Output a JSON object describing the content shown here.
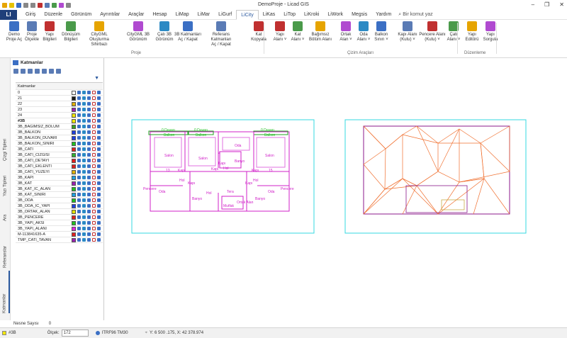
{
  "window": {
    "title": "DemoProje - Licad GIS"
  },
  "menubar": {
    "logo": "LI",
    "tabs": [
      "Giriş",
      "Düzenle",
      "Görünüm",
      "Ayrıntılar",
      "Araçlar",
      "Hesap",
      "LiMap",
      "LiMar",
      "LiGurf",
      "LiCity",
      "LiKas",
      "LiTop",
      "LiKroki",
      "LiWork",
      "Megsis",
      "Yardım"
    ],
    "active_tab": "LiCity",
    "search_label": "Bir komut yaz"
  },
  "ribbon": {
    "proje_buttons": [
      {
        "label1": "Demo",
        "label2": "Proje Aç",
        "icon": "project-open-icon"
      },
      {
        "label1": "Proje",
        "label2": "Ölçekle",
        "icon": "scale-icon"
      },
      {
        "label1": "Yapı",
        "label2": "Bilgileri",
        "icon": "building-info-icon"
      },
      {
        "label1": "Dönüşüm",
        "label2": "Bilgileri",
        "icon": "transform-icon"
      },
      {
        "label1": "CityGML",
        "label2": "Oluşturma Sihirbazı",
        "icon": "citygml-icon"
      },
      {
        "label1": "CityGML 3B",
        "label2": "Görünüm",
        "icon": "citygml-3d-icon"
      },
      {
        "label1": "Çatı 3B",
        "label2": "Görünüm",
        "icon": "roof-3d-icon"
      },
      {
        "label1": "3B Katmanları",
        "label2": "Aç / Kapat",
        "icon": "layers-3d-icon"
      },
      {
        "label1": "Referans Katmanları",
        "label2": "Aç / Kapat",
        "icon": "ref-layers-icon"
      },
      {
        "label1": "Kat",
        "label2": "Kopyala",
        "icon": "floor-copy-icon"
      }
    ],
    "cizim_buttons": [
      {
        "label1": "Yapı",
        "label2": "Alanı ˅",
        "icon": "building-area-icon"
      },
      {
        "label1": "Kat",
        "label2": "Alanı ˅",
        "icon": "floor-area-icon"
      },
      {
        "label1": "Bağımsız",
        "label2": "Bölüm Alanı",
        "icon": "unit-area-icon"
      },
      {
        "label1": "Ortak",
        "label2": "Alan ˅",
        "icon": "common-area-icon"
      },
      {
        "label1": "Oda",
        "label2": "Alanı ˅",
        "icon": "room-area-icon"
      },
      {
        "label1": "Balkon",
        "label2": "Sınırı ˅",
        "icon": "balcony-icon"
      },
      {
        "label1": "Kapı Alanı",
        "label2": "(Kutu) ˅",
        "icon": "door-area-icon"
      },
      {
        "label1": "Pencere Alanı",
        "label2": "(Kutu) ˅",
        "icon": "window-area-icon"
      },
      {
        "label1": "Çatı",
        "label2": "Alanı ˅",
        "icon": "roof-area-icon"
      }
    ],
    "duzenleme_buttons": [
      {
        "label1": "Yapı",
        "label2": "Editörü",
        "icon": "building-editor-icon"
      },
      {
        "label1": "Yapı",
        "label2": "Sorgula",
        "icon": "building-query-icon"
      }
    ],
    "groups": {
      "proje": "Proje",
      "cizim": "Çizim Araçları",
      "duzenleme": "Düzenleme"
    }
  },
  "sidebar_tabs": [
    "Katmanlar",
    "Referanslar",
    "Ara",
    "Yazı Tipleri",
    "Çizgi Tipleri"
  ],
  "panel": {
    "title": "Katmanlar",
    "column_header": "Katmanlar",
    "layers": [
      {
        "name": "0",
        "color": "#ffffff"
      },
      {
        "name": "21",
        "color": "#1a1a1a"
      },
      {
        "name": "22",
        "color": "#e0b000"
      },
      {
        "name": "23",
        "color": "#9b1fb0"
      },
      {
        "name": "24",
        "color": "#f2e600"
      },
      {
        "name": "#3B",
        "color": "#f2e600",
        "current": true
      },
      {
        "name": "3B_BAGIMSIZ_BOLUM",
        "color": "#3aa020"
      },
      {
        "name": "3B_BALKON",
        "color": "#2040e0"
      },
      {
        "name": "3B_BALKON_DUVARI",
        "color": "#2040e0"
      },
      {
        "name": "3B_BALKON_SINIRI",
        "color": "#20c020"
      },
      {
        "name": "3B_CATI",
        "color": "#e02020"
      },
      {
        "name": "3B_CATI_CIZGISI",
        "color": "#30b030"
      },
      {
        "name": "3B_CATI_DETAYI",
        "color": "#e02020"
      },
      {
        "name": "3B_CATI_EKLENTI",
        "color": "#e02020"
      },
      {
        "name": "3B_CATI_YUZEYI",
        "color": "#e0b000"
      },
      {
        "name": "3B_KAPI",
        "color": "#20a0e0"
      },
      {
        "name": "3B_KAT",
        "color": "#9b1fb0"
      },
      {
        "name": "3B_KAT_IC_ALAN",
        "color": "#20c020"
      },
      {
        "name": "3B_KAT_SINIRI",
        "color": "#20a0e0"
      },
      {
        "name": "3B_ODA",
        "color": "#20c020"
      },
      {
        "name": "3B_ODA_IC_YAPI",
        "color": "#2040e0"
      },
      {
        "name": "3B_ORTAK_ALAN",
        "color": "#e0e000"
      },
      {
        "name": "3B_PENCERE",
        "color": "#e02020"
      },
      {
        "name": "3B_YAPI_AKSI",
        "color": "#20c020"
      },
      {
        "name": "3B_YAPI_ALANI",
        "color": "#e020e0"
      },
      {
        "name": "M-113841635-A",
        "color": "#e02020"
      },
      {
        "name": "TMP_CATI_TAVAN",
        "color": "#9b1fb0"
      }
    ],
    "count_label": "Nesne Sayısı",
    "count_value": "0"
  },
  "floorplan": {
    "labels": {
      "balkon1": "0 Duvarı",
      "balkon1b": "Balkon",
      "balkon2": "0 Duvarı",
      "balkon2b": "Balkon",
      "balkon3": "0 Duvarı",
      "balkon3b": "Balkon",
      "salon1": "Salon",
      "salon2": "Salon",
      "oda1": "Oda",
      "salon3": "Salon",
      "n13": "13",
      "n15": "15",
      "n4": "4",
      "kapi1": "Kapı",
      "kapi2": "Kapı",
      "kapi3": "Kapı",
      "kapi4": "Kapı",
      "kapi5": "Kapı",
      "kapi6": "Kapı",
      "hol1": "Hol",
      "hol2": "Hol",
      "hol3": "Hol",
      "hol4": "Hol",
      "banyo1": "Banyo",
      "banyo2": "Banyo",
      "banyo3": "Banyo",
      "pencere1": "Pencere",
      "pencere2": "Pencere",
      "oda2": "Oda",
      "oda3": "Oda",
      "tera": "Tera",
      "ortak": "Ortak Alan",
      "mutfak": "Mutfak"
    }
  },
  "status": {
    "layer": "#3B",
    "scale_label": "Ölçek:",
    "scale_value": "172",
    "crs": "ITRF96 TM30",
    "coords": "Y: 6 500 .175, X: 42 378.974"
  }
}
